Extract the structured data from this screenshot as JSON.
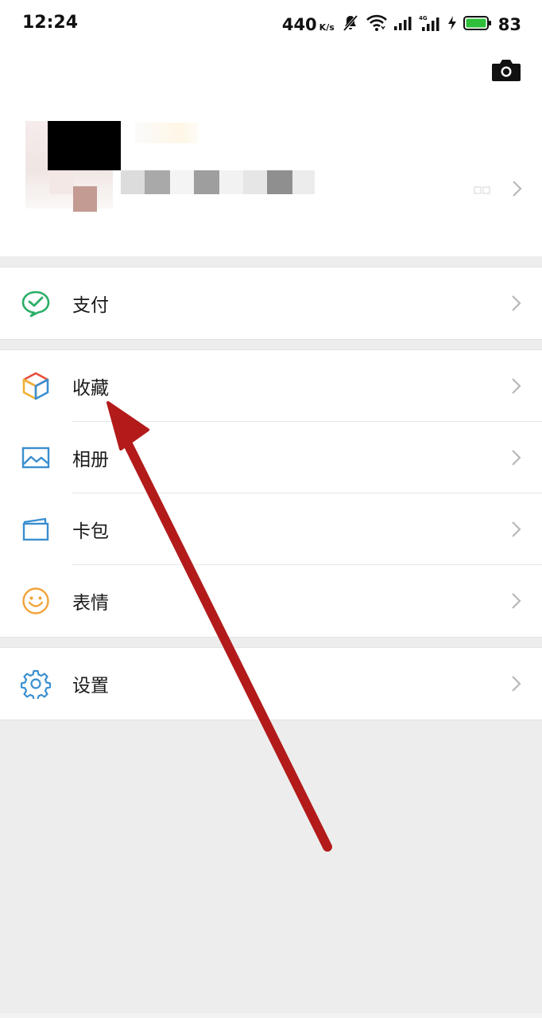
{
  "status_bar": {
    "time": "12:24",
    "net_speed": "440",
    "net_speed_unit": "K/s",
    "battery_percent": "83",
    "icons": [
      "mute-icon",
      "wifi-icon",
      "signal-icon",
      "signal-4g-icon",
      "charging-icon",
      "battery-icon"
    ]
  },
  "header": {
    "camera_icon": "camera-icon"
  },
  "menu": {
    "pay": {
      "label": "支付",
      "icon": "wechat-pay-icon",
      "color": "#2aae67"
    },
    "favorites": {
      "label": "收藏",
      "icon": "favorites-cube-icon"
    },
    "album": {
      "label": "相册",
      "icon": "album-icon",
      "color": "#3a8fd0"
    },
    "card_wallet": {
      "label": "卡包",
      "icon": "card-wallet-icon",
      "color": "#3a8fd0"
    },
    "stickers": {
      "label": "表情",
      "icon": "sticker-smile-icon",
      "color": "#f2a33a"
    },
    "settings": {
      "label": "设置",
      "icon": "gear-icon",
      "color": "#3a8fd0"
    }
  },
  "colors": {
    "background": "#ededed",
    "annotation_arrow": "#b31b1b"
  }
}
